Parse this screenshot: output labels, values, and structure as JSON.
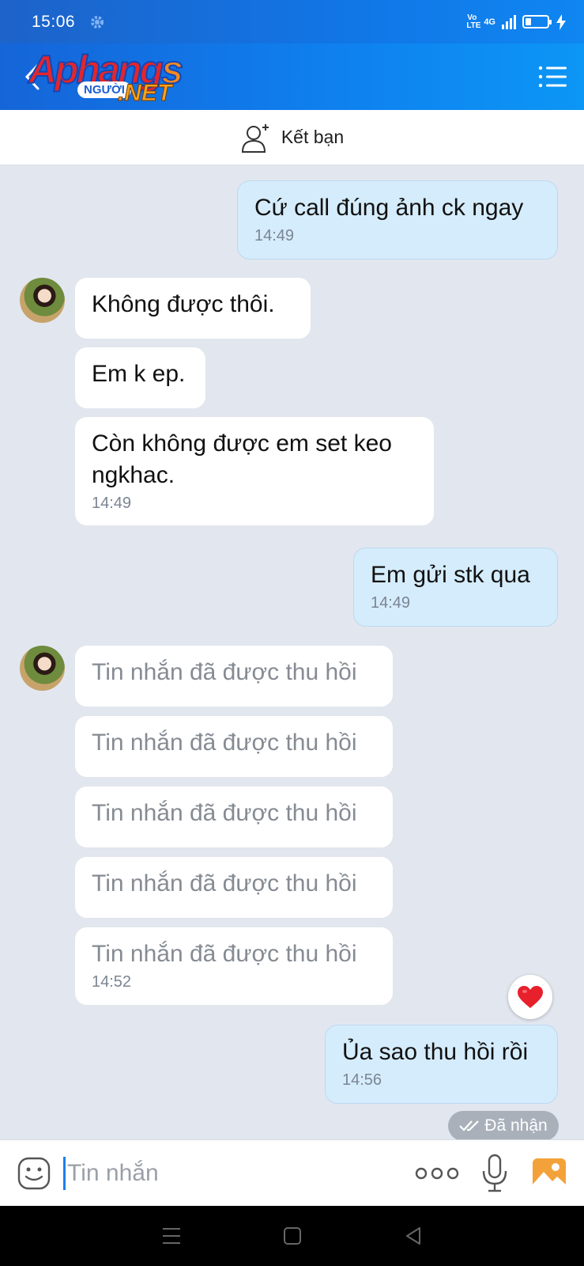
{
  "status_bar": {
    "time": "15:06",
    "network": "4G",
    "volte": "Vo LTE"
  },
  "header": {
    "logo_main": "Aphang",
    "logo_main_s": "s",
    "logo_tag": "NGƯỜI",
    "logo_net": ".NET"
  },
  "friend_bar": {
    "label": "Kết bạn"
  },
  "messages": [
    {
      "direction": "out",
      "text": "Cứ call đúng ảnh ck ngay",
      "time": "14:49"
    },
    {
      "direction": "in",
      "text": "Không được thôi."
    },
    {
      "direction": "in",
      "text": "Em k ep."
    },
    {
      "direction": "in",
      "text": "Còn không được em set keo ngkhac.",
      "time": "14:49"
    },
    {
      "direction": "out",
      "text": "Em gửi stk qua",
      "time": "14:49"
    },
    {
      "direction": "in",
      "text": "Tin nhắn đã được thu hồi",
      "recalled": true
    },
    {
      "direction": "in",
      "text": "Tin nhắn đã được thu hồi",
      "recalled": true
    },
    {
      "direction": "in",
      "text": "Tin nhắn đã được thu hồi",
      "recalled": true
    },
    {
      "direction": "in",
      "text": "Tin nhắn đã được thu hồi",
      "recalled": true
    },
    {
      "direction": "in",
      "text": "Tin nhắn đã được thu hồi",
      "recalled": true,
      "time": "14:52"
    },
    {
      "direction": "out",
      "text": "Ủa sao thu hồi rồi",
      "time": "14:56"
    }
  ],
  "received_status": "Đã nhận",
  "input": {
    "placeholder": "Tin nhắn"
  },
  "colors": {
    "accent": "#1a7ff0",
    "outgoing_bubble": "#d5ecfc",
    "incoming_bubble": "#ffffff",
    "chat_bg": "#e2e7ef"
  },
  "icons": [
    "gear-icon",
    "back-arrow-icon",
    "menu-list-icon",
    "add-friend-icon",
    "heart-icon",
    "double-check-icon",
    "emoji-icon",
    "more-dots-icon",
    "microphone-icon",
    "image-icon",
    "nav-menu-icon",
    "nav-home-icon",
    "nav-back-icon"
  ]
}
